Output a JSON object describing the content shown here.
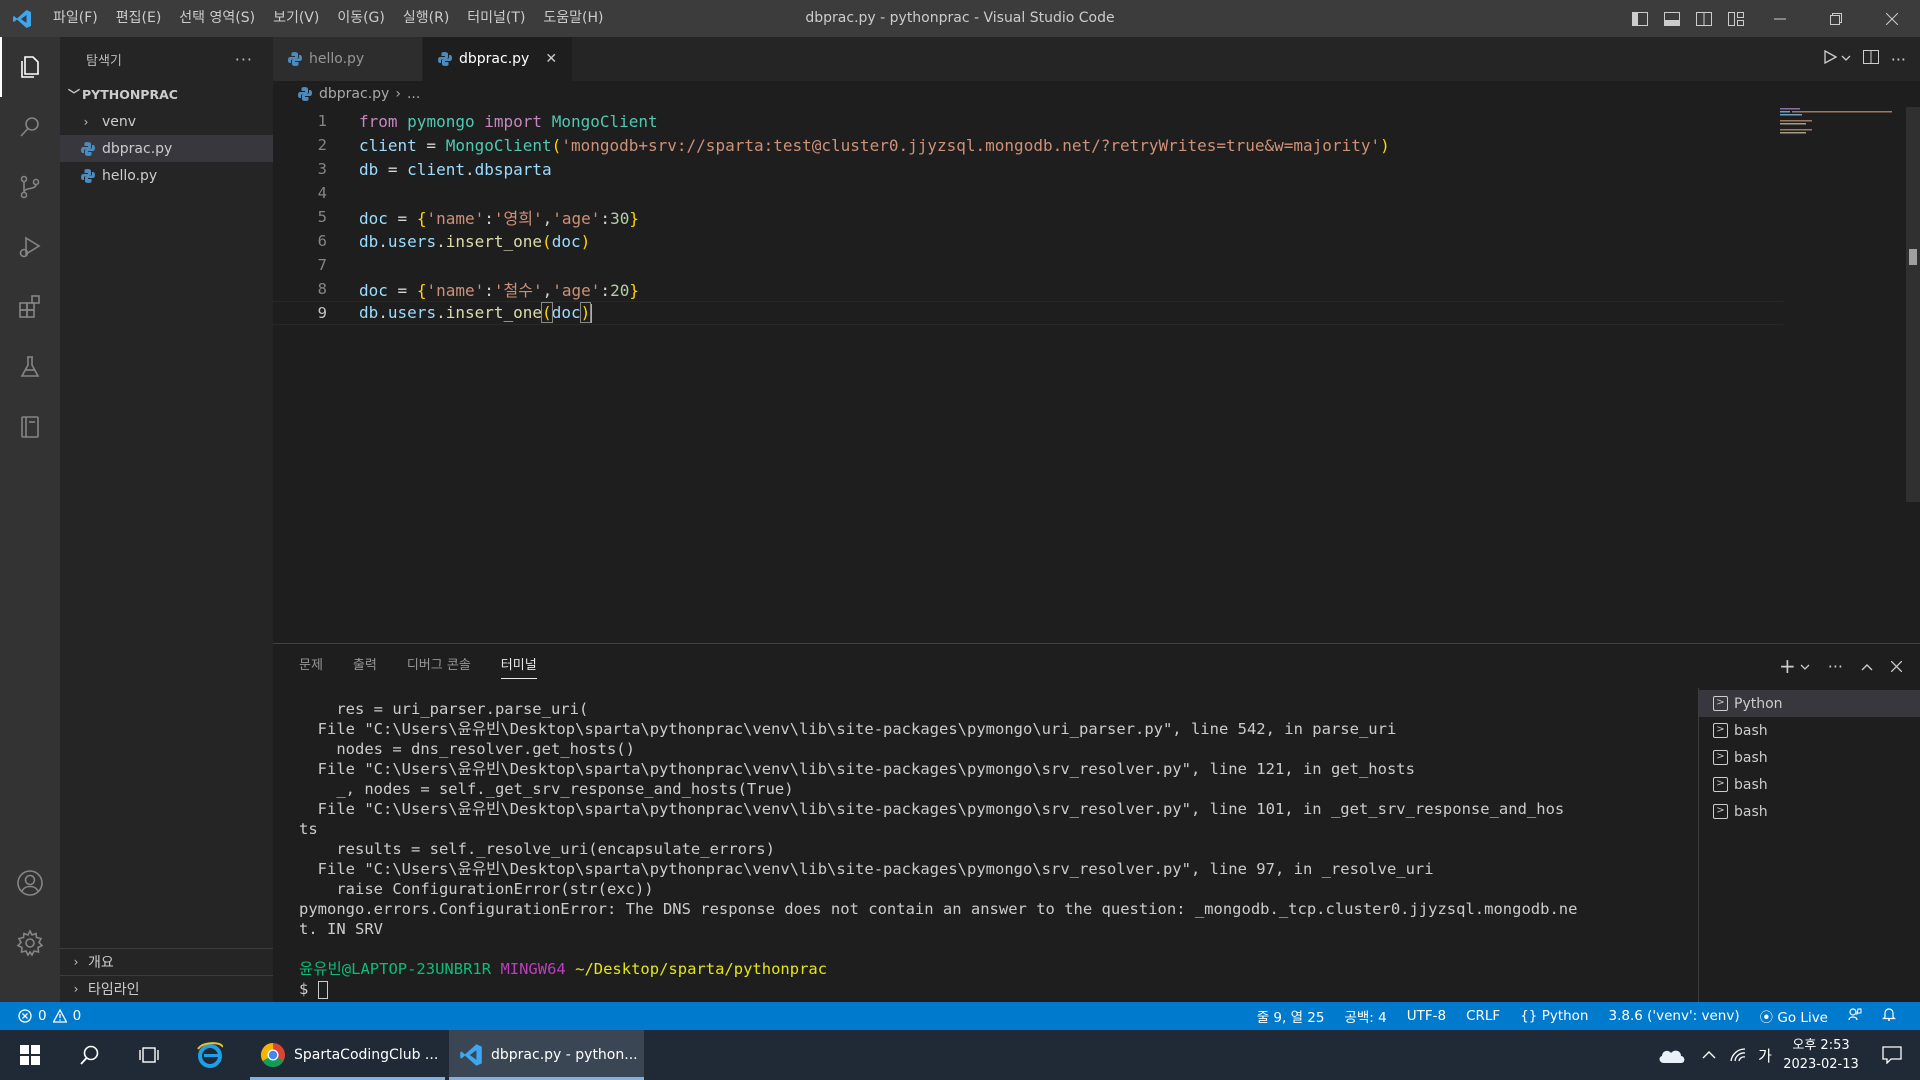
{
  "window": {
    "title": "dbprac.py - pythonprac - Visual Studio Code",
    "menu": [
      "파일(F)",
      "편집(E)",
      "선택 영역(S)",
      "보기(V)",
      "이동(G)",
      "실행(R)",
      "터미널(T)",
      "도움말(H)"
    ]
  },
  "sidebar": {
    "title": "탐색기",
    "more": "···",
    "folder": "PYTHONPRAC",
    "items": [
      {
        "label": "venv",
        "type": "folder"
      },
      {
        "label": "dbprac.py",
        "type": "file"
      },
      {
        "label": "hello.py",
        "type": "file"
      }
    ],
    "outline": "개요",
    "timeline": "타임라인"
  },
  "tabs": [
    {
      "label": "hello.py"
    },
    {
      "label": "dbprac.py",
      "close": "✕"
    }
  ],
  "breadcrumb": {
    "file": "dbprac.py",
    "sep": "›",
    "rest": "..."
  },
  "editor": {
    "lines": [
      "1",
      "2",
      "3",
      "4",
      "5",
      "6",
      "7",
      "8",
      "9"
    ],
    "code": {
      "l1": {
        "from": "from",
        "mod": "pymongo",
        "imp": "import",
        "cls": "MongoClient"
      },
      "l2": {
        "var": "client",
        "eq": " = ",
        "cls": "MongoClient",
        "open": "(",
        "str": "'mongodb+srv://sparta:test@cluster0.jjyzsql.mongodb.net/?retryWrites=true&w=majority'",
        "close": ")"
      },
      "l3": {
        "var": "db",
        "eq": " = ",
        "obj": "client",
        "dot": ".",
        "attr": "dbsparta"
      },
      "l5": {
        "var": "doc",
        "eq": " = ",
        "open": "{",
        "k1": "'name'",
        "c1": ":",
        "v1": "'영희'",
        "cm": ",",
        "k2": "'age'",
        "c2": ":",
        "v2": "30",
        "close": "}"
      },
      "l6": {
        "obj": "db",
        "d1": ".",
        "users": "users",
        "d2": ".",
        "fn": "insert_one",
        "open": "(",
        "arg": "doc",
        "close": ")"
      },
      "l8": {
        "var": "doc",
        "eq": " = ",
        "open": "{",
        "k1": "'name'",
        "c1": ":",
        "v1": "'철수'",
        "cm": ",",
        "k2": "'age'",
        "c2": ":",
        "v2": "20",
        "close": "}"
      },
      "l9": {
        "obj": "db",
        "d1": ".",
        "users": "users",
        "d2": ".",
        "fn": "insert_one",
        "open": "(",
        "arg": "doc",
        "close": ")"
      }
    }
  },
  "panel": {
    "tabs": [
      "문제",
      "출력",
      "디버그 콘솔",
      "터미널"
    ],
    "terminal_lines": [
      "    res = uri_parser.parse_uri(",
      "  File \"C:\\Users\\윤유빈\\Desktop\\sparta\\pythonprac\\venv\\lib\\site-packages\\pymongo\\uri_parser.py\", line 542, in parse_uri",
      "    nodes = dns_resolver.get_hosts()",
      "  File \"C:\\Users\\윤유빈\\Desktop\\sparta\\pythonprac\\venv\\lib\\site-packages\\pymongo\\srv_resolver.py\", line 121, in get_hosts",
      "    _, nodes = self._get_srv_response_and_hosts(True)",
      "  File \"C:\\Users\\윤유빈\\Desktop\\sparta\\pythonprac\\venv\\lib\\site-packages\\pymongo\\srv_resolver.py\", line 101, in _get_srv_response_and_hos",
      "ts",
      "    results = self._resolve_uri(encapsulate_errors)",
      "  File \"C:\\Users\\윤유빈\\Desktop\\sparta\\pythonprac\\venv\\lib\\site-packages\\pymongo\\srv_resolver.py\", line 97, in _resolve_uri",
      "    raise ConfigurationError(str(exc))",
      "pymongo.errors.ConfigurationError: The DNS response does not contain an answer to the question: _mongodb._tcp.cluster0.jjyzsql.mongodb.ne",
      "t. IN SRV"
    ],
    "prompt": {
      "user": "윤유빈@LAPTOP-23UNBR1R",
      "env": "MINGW64",
      "path": "~/Desktop/sparta/pythonprac",
      "symbol": "$"
    },
    "terminals": [
      "Python",
      "bash",
      "bash",
      "bash",
      "bash"
    ]
  },
  "status": {
    "errors": "0",
    "warnings": "0",
    "position": "줄 9, 열 25",
    "spaces": "공백: 4",
    "encoding": "UTF-8",
    "eol": "CRLF",
    "language": "Python",
    "interpreter": "3.8.6 ('venv': venv)",
    "golive": "Go Live"
  },
  "taskbar": {
    "apps": [
      {
        "label": "SpartaCodingClub ..."
      },
      {
        "label": "dbprac.py - python..."
      }
    ],
    "ime": "가",
    "time": "오후 2:53",
    "date": "2023-02-13"
  },
  "colors": {
    "accent": "#007acc",
    "titlebar": "#3c3c3c",
    "editor_bg": "#1e1e1e"
  }
}
